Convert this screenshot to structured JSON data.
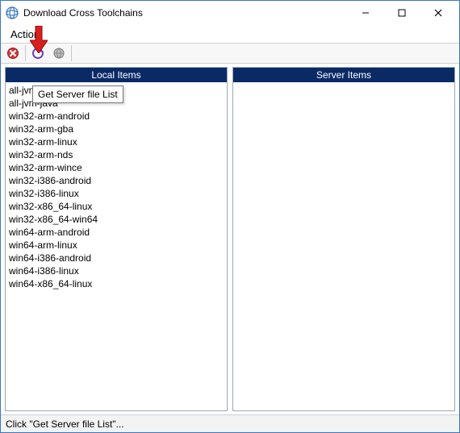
{
  "window": {
    "title": "Download Cross Toolchains"
  },
  "menubar": {
    "action": "Action"
  },
  "toolbar": {
    "tooltip": "Get Server file List"
  },
  "panels": {
    "local_header": "Local Items",
    "server_header": "Server Items",
    "local_items": [
      "all-jvm-android",
      "all-jvm-java",
      "win32-arm-android",
      "win32-arm-gba",
      "win32-arm-linux",
      "win32-arm-nds",
      "win32-arm-wince",
      "win32-i386-android",
      "win32-i386-linux",
      "win32-x86_64-linux",
      "win32-x86_64-win64",
      "win64-arm-android",
      "win64-arm-linux",
      "win64-i386-android",
      "win64-i386-linux",
      "win64-x86_64-linux"
    ]
  },
  "statusbar": {
    "text": "Click \"Get Server file List\"..."
  }
}
